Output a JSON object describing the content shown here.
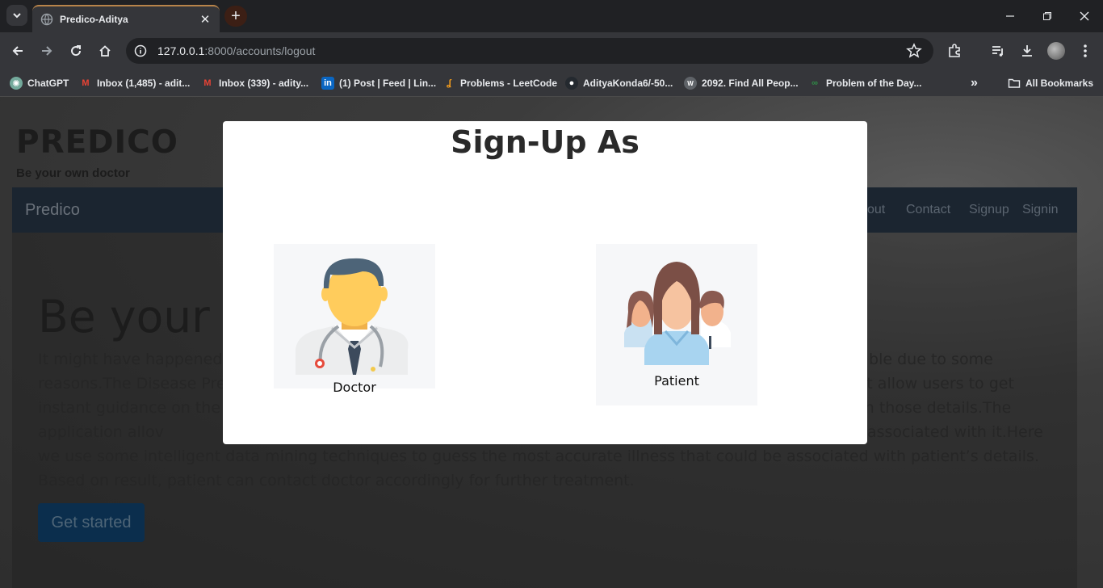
{
  "browser": {
    "tab_title": "Predico-Aditya",
    "url_host": "127.0.0.1",
    "url_path": ":8000/accounts/logout",
    "bookmarks": [
      {
        "label": "ChatGPT"
      },
      {
        "label": "Inbox (1,485) - adit..."
      },
      {
        "label": "Inbox (339) - adity..."
      },
      {
        "label": "(1) Post | Feed | Lin..."
      },
      {
        "label": "Problems - LeetCode"
      },
      {
        "label": "AdityaKonda6/-50..."
      },
      {
        "label": "2092. Find All Peop..."
      },
      {
        "label": "Problem of the Day..."
      }
    ],
    "all_bookmarks": "All Bookmarks"
  },
  "site": {
    "brand": "PREDICO",
    "tagline": "Be your own doctor",
    "nav_brand": "Predico",
    "nav_links": [
      "out",
      "Contact",
      "Signup",
      "Signin"
    ],
    "hero_title": "Be your ov",
    "hero_text": "It might have happened so                                                                                                                                ble due to some reasons.The Disease Predict                                                                                                            lication that allow users to get instant guidance on the                                                                                                         se associated with those details.The application allov                                                                                                         ous illness that could be associated with it.Here we use some intelligent data mining techniques to guess the most accurate illness that could be associated with patient’s details. Based on result, patient can contact doctor accordingly for further treatment.",
    "cta": "Get started"
  },
  "modal": {
    "title": "Sign-Up As",
    "options": [
      {
        "label": "Doctor",
        "icon": "doctor-avatar"
      },
      {
        "label": "Patient",
        "icon": "patients-group"
      }
    ]
  }
}
